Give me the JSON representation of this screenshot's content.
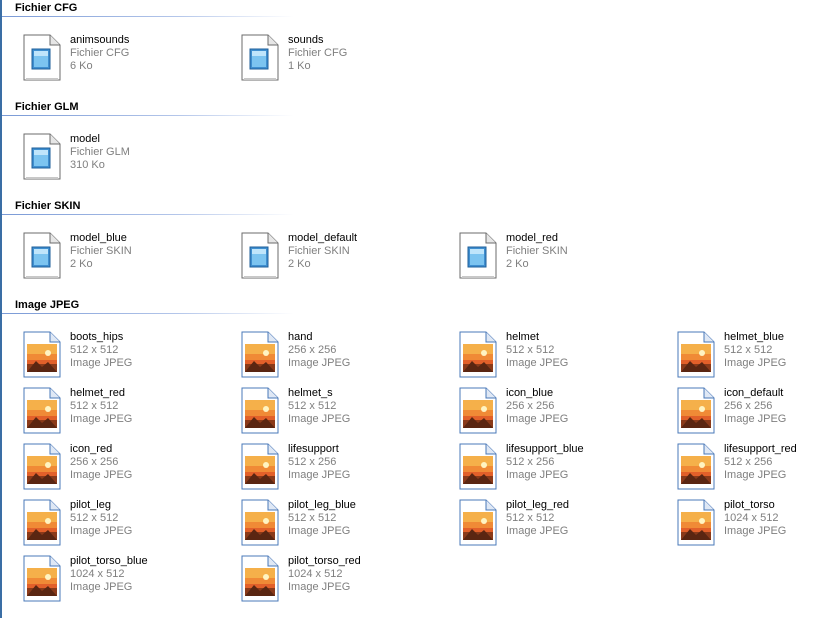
{
  "groups": [
    {
      "title": "Fichier CFG",
      "icon": "config-file-icon",
      "items": [
        {
          "name": "animsounds",
          "line1": "Fichier CFG",
          "line2": "6 Ko"
        },
        {
          "name": "sounds",
          "line1": "Fichier CFG",
          "line2": "1 Ko"
        }
      ]
    },
    {
      "title": "Fichier GLM",
      "icon": "model-file-icon",
      "items": [
        {
          "name": "model",
          "line1": "Fichier GLM",
          "line2": "310 Ko"
        }
      ]
    },
    {
      "title": "Fichier SKIN",
      "icon": "skin-file-icon",
      "items": [
        {
          "name": "model_blue",
          "line1": "Fichier SKIN",
          "line2": "2 Ko"
        },
        {
          "name": "model_default",
          "line1": "Fichier SKIN",
          "line2": "2 Ko"
        },
        {
          "name": "model_red",
          "line1": "Fichier SKIN",
          "line2": "2 Ko"
        }
      ]
    },
    {
      "title": "Image JPEG",
      "icon": "jpeg-image-icon",
      "items": [
        {
          "name": "boots_hips",
          "line1": "512 x 512",
          "line2": "Image JPEG"
        },
        {
          "name": "hand",
          "line1": "256 x 256",
          "line2": "Image JPEG"
        },
        {
          "name": "helmet",
          "line1": "512 x 512",
          "line2": "Image JPEG"
        },
        {
          "name": "helmet_blue",
          "line1": "512 x 512",
          "line2": "Image JPEG"
        },
        {
          "name": "helmet_red",
          "line1": "512 x 512",
          "line2": "Image JPEG"
        },
        {
          "name": "helmet_s",
          "line1": "512 x 512",
          "line2": "Image JPEG"
        },
        {
          "name": "icon_blue",
          "line1": "256 x 256",
          "line2": "Image JPEG"
        },
        {
          "name": "icon_default",
          "line1": "256 x 256",
          "line2": "Image JPEG"
        },
        {
          "name": "icon_red",
          "line1": "256 x 256",
          "line2": "Image JPEG"
        },
        {
          "name": "lifesupport",
          "line1": "512 x 256",
          "line2": "Image JPEG"
        },
        {
          "name": "lifesupport_blue",
          "line1": "512 x 256",
          "line2": "Image JPEG"
        },
        {
          "name": "lifesupport_red",
          "line1": "512 x 256",
          "line2": "Image JPEG"
        },
        {
          "name": "pilot_leg",
          "line1": "512 x 512",
          "line2": "Image JPEG"
        },
        {
          "name": "pilot_leg_blue",
          "line1": "512 x 512",
          "line2": "Image JPEG"
        },
        {
          "name": "pilot_leg_red",
          "line1": "512 x 512",
          "line2": "Image JPEG"
        },
        {
          "name": "pilot_torso",
          "line1": "1024 x 512",
          "line2": "Image JPEG"
        },
        {
          "name": "pilot_torso_blue",
          "line1": "1024 x 512",
          "line2": "Image JPEG"
        },
        {
          "name": "pilot_torso_red",
          "line1": "1024 x 512",
          "line2": "Image JPEG"
        }
      ]
    }
  ]
}
